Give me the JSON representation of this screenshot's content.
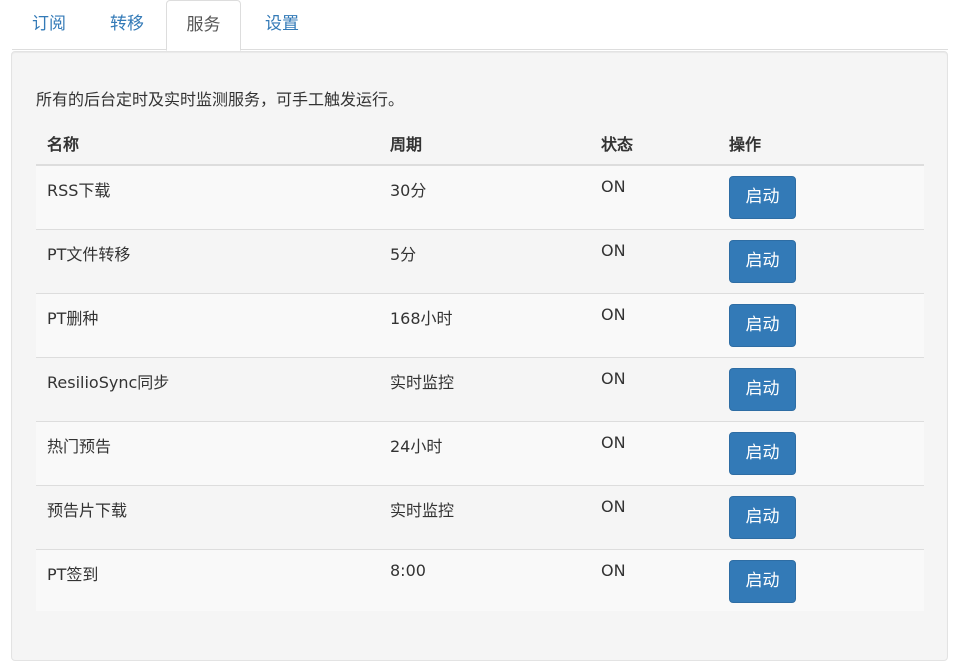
{
  "tabs": [
    {
      "label": "订阅",
      "active": false
    },
    {
      "label": "转移",
      "active": false
    },
    {
      "label": "服务",
      "active": true
    },
    {
      "label": "设置",
      "active": false
    }
  ],
  "panel": {
    "description": "所有的后台定时及实时监测服务，可手工触发运行。"
  },
  "table": {
    "headers": {
      "name": "名称",
      "period": "周期",
      "status": "状态",
      "action": "操作"
    },
    "rows": [
      {
        "name": "RSS下载",
        "period": "30分",
        "status": "ON",
        "action": "启动"
      },
      {
        "name": "PT文件转移",
        "period": "5分",
        "status": "ON",
        "action": "启动"
      },
      {
        "name": "PT删种",
        "period": "168小时",
        "status": "ON",
        "action": "启动"
      },
      {
        "name": "ResilioSync同步",
        "period": "实时监控",
        "status": "ON",
        "action": "启动"
      },
      {
        "name": "热门预告",
        "period": "24小时",
        "status": "ON",
        "action": "启动"
      },
      {
        "name": "预告片下载",
        "period": "实时监控",
        "status": "ON",
        "action": "启动"
      },
      {
        "name": "PT签到",
        "period": "8:00",
        "status": "ON",
        "action": "启动"
      }
    ]
  },
  "colors": {
    "link": "#337ab7",
    "primary_button": "#337ab7",
    "panel_bg": "#f5f5f5",
    "stripe_bg": "#f9f9f9"
  }
}
